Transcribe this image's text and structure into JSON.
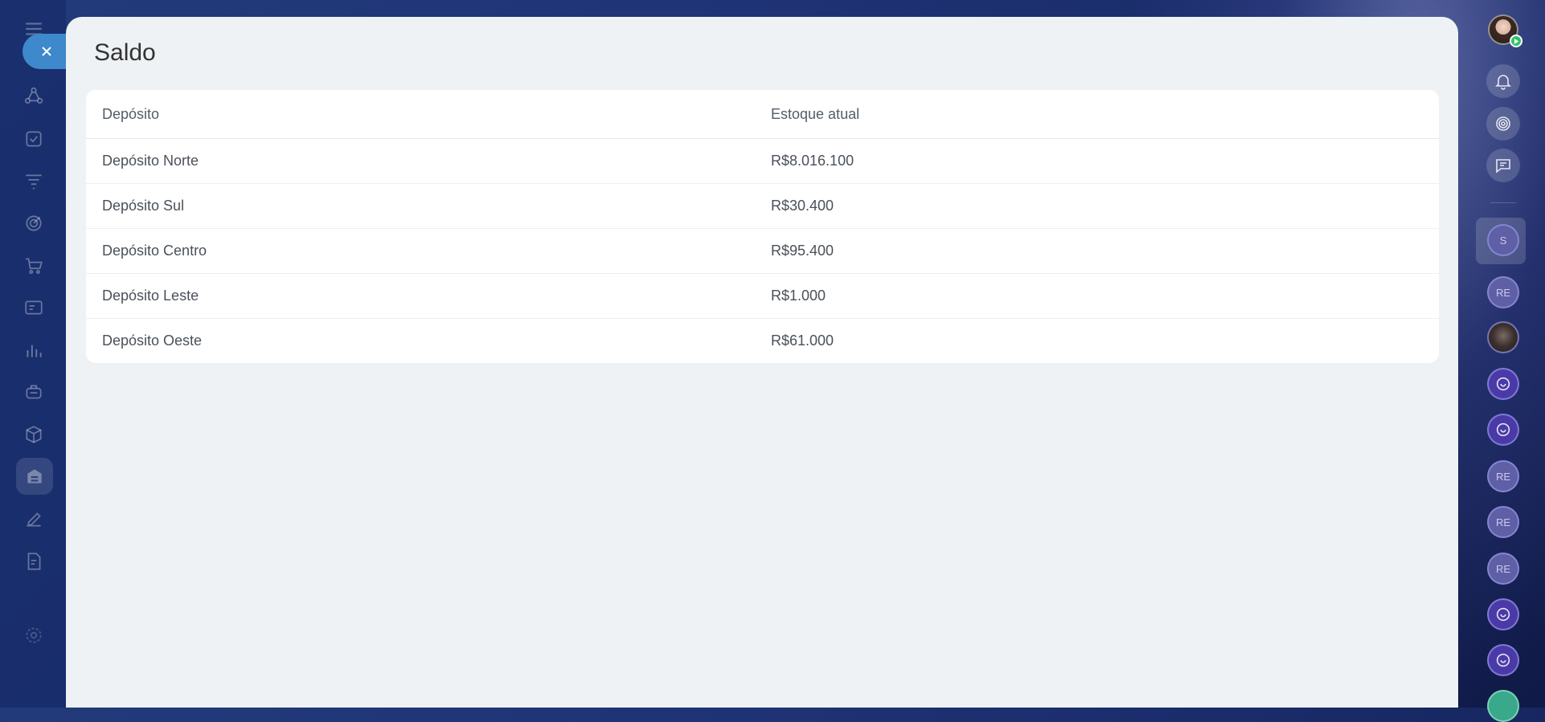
{
  "page": {
    "title": "Saldo"
  },
  "table": {
    "headers": [
      "Depósito",
      "Estoque atual"
    ],
    "rows": [
      [
        "Depósito Norte",
        "R$8.016.100"
      ],
      [
        "Depósito Sul",
        "R$30.400"
      ],
      [
        "Depósito Centro",
        "R$95.400"
      ],
      [
        "Depósito Leste",
        "R$1.000"
      ],
      [
        "Depósito Oeste",
        "R$61.000"
      ]
    ]
  },
  "left_rail": {
    "icons": [
      "menu-icon",
      "crm-icon",
      "tasks-icon",
      "sales-funnel-icon",
      "target-icon",
      "cart-icon",
      "contact-center-icon",
      "analytics-icon",
      "automation-icon",
      "inventory-icon",
      "warehouse-icon",
      "sign-icon",
      "document-icon",
      "settings-icon"
    ]
  },
  "right_rail": {
    "chat_avatars": [
      {
        "type": "letter",
        "text": "S"
      },
      {
        "type": "letter",
        "text": "RE"
      },
      {
        "type": "photo",
        "text": ""
      },
      {
        "type": "openline",
        "text": ""
      },
      {
        "type": "openline",
        "text": ""
      },
      {
        "type": "letter",
        "text": "RE"
      },
      {
        "type": "letter",
        "text": "RE"
      },
      {
        "type": "letter",
        "text": "RE"
      },
      {
        "type": "openline",
        "text": ""
      },
      {
        "type": "openline",
        "text": ""
      },
      {
        "type": "green",
        "text": ""
      }
    ]
  },
  "colors": {
    "accent": "#3e88cc",
    "panel_bg": "#eef2f4",
    "online": "#2fc26b"
  }
}
